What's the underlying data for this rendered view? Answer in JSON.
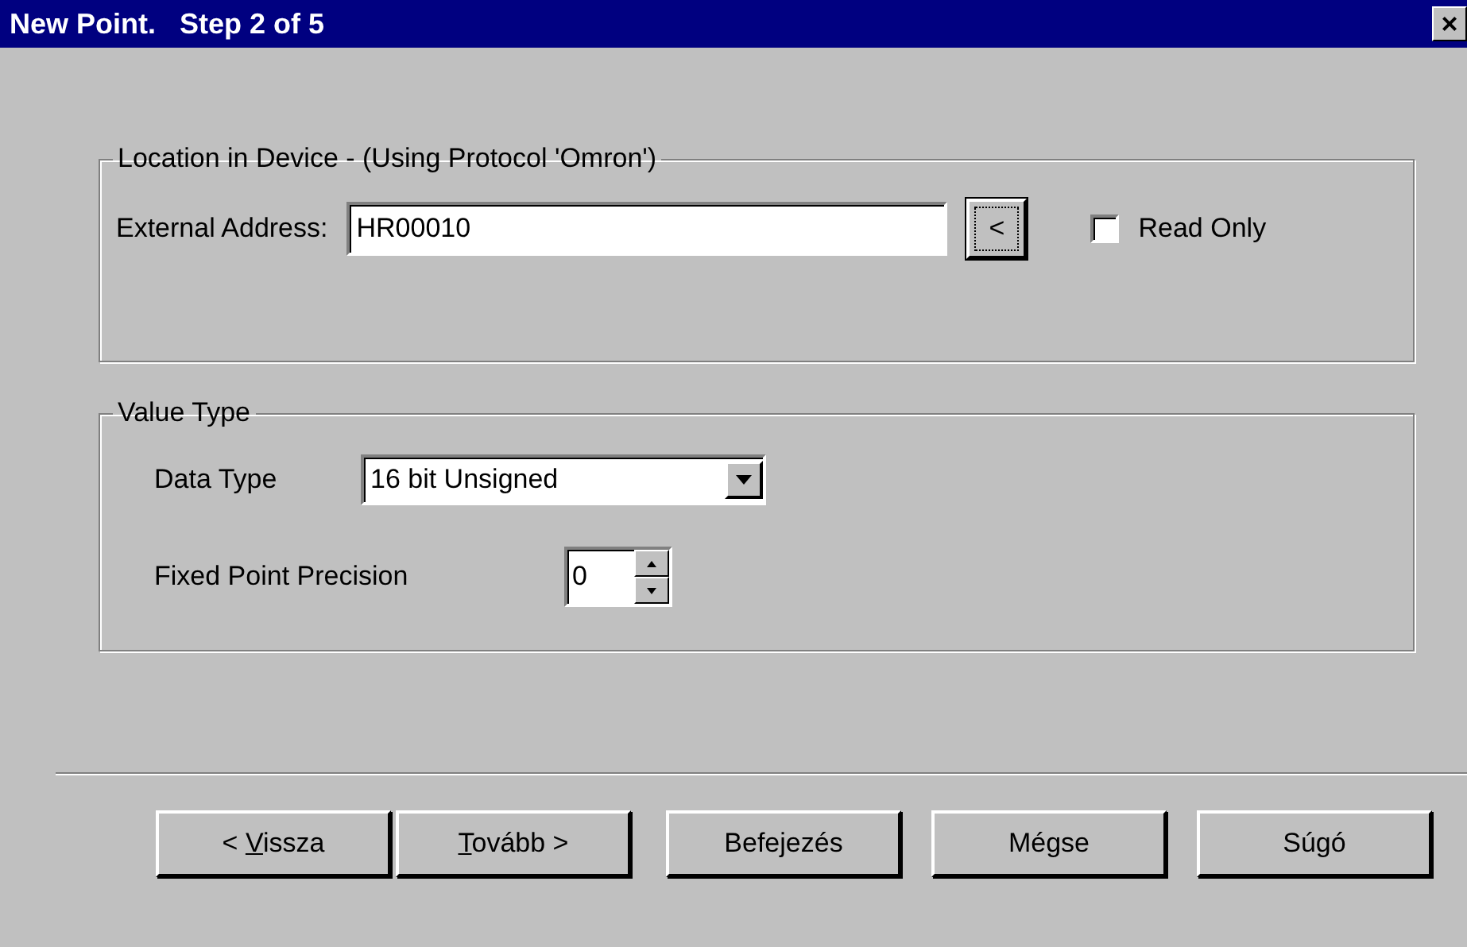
{
  "window": {
    "title": "New Point.   Step 2 of 5",
    "close": "×"
  },
  "location_group": {
    "legend": "Location in Device - (Using Protocol 'Omron')",
    "address_label": "External Address:",
    "address_value": "HR00010",
    "browse_button": "<",
    "read_only": {
      "label": "Read Only",
      "checked": false
    }
  },
  "value_group": {
    "legend": "Value Type",
    "data_type_label": "Data Type",
    "data_type_value": "16 bit Unsigned",
    "precision_label": "Fixed Point Precision",
    "precision_value": "0"
  },
  "buttons": [
    {
      "before": "< ",
      "access_key": "V",
      "after": "issza"
    },
    {
      "access_key": "T",
      "after": "ovább >"
    },
    {
      "after": "Befejezés"
    },
    {
      "after": "Mégse"
    },
    {
      "after": "Súgó"
    }
  ]
}
